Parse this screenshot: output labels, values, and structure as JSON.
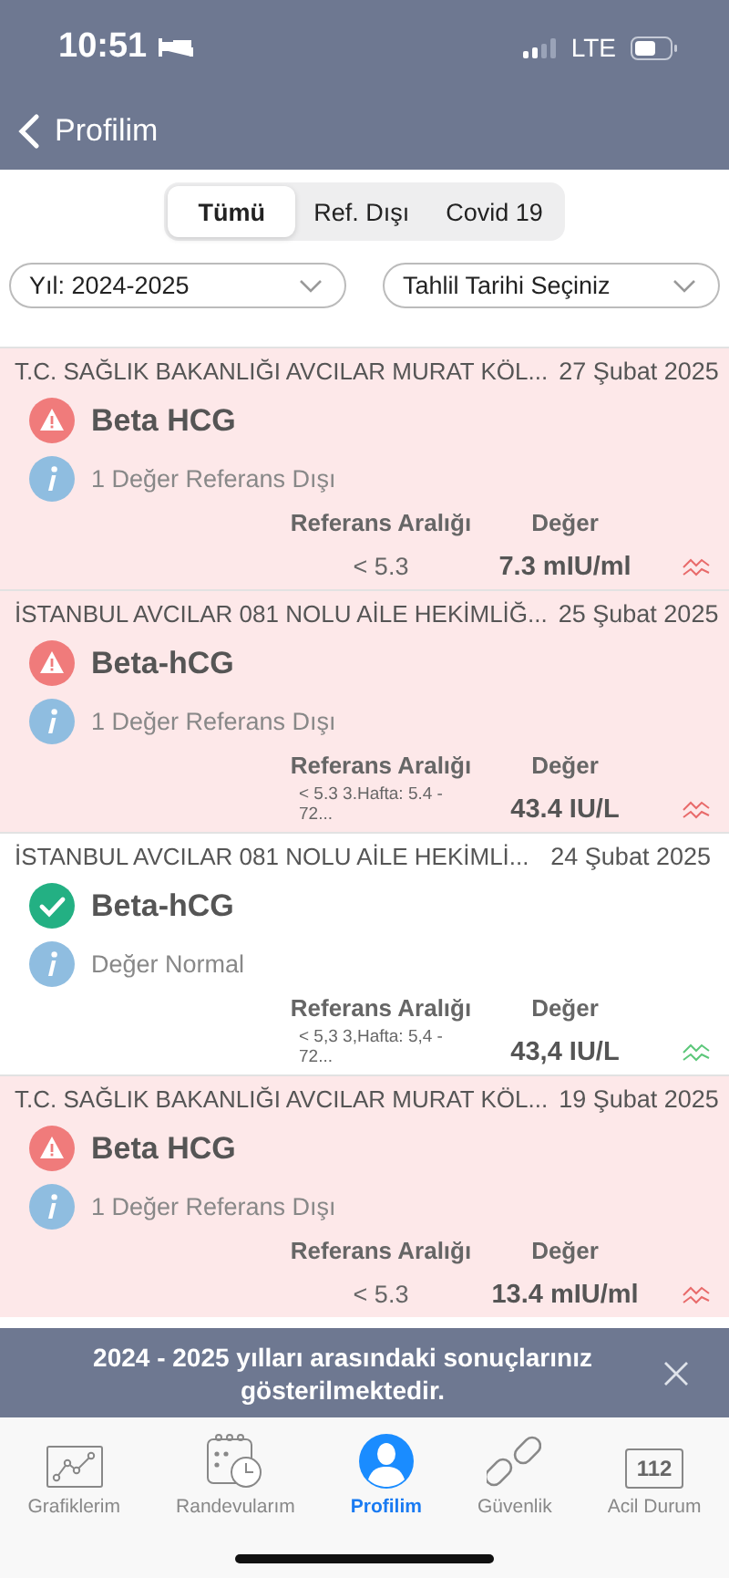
{
  "status_bar": {
    "time": "10:51",
    "network": "LTE"
  },
  "nav": {
    "back": "Profilim"
  },
  "segments": [
    {
      "label": "Tümü",
      "selected": true
    },
    {
      "label": "Ref. Dışı",
      "selected": false
    },
    {
      "label": "Covid 19",
      "selected": false
    }
  ],
  "filters": [
    {
      "value": "Yıl: 2024-2025"
    },
    {
      "value": "Tahlil Tarihi Seçiniz"
    }
  ],
  "results": [
    {
      "facility": "T.C. SAĞLIK BAKANLIĞI AVCILAR MURAT KÖL...",
      "date": "27 Şubat 2025",
      "kind": "abnormal",
      "test": "Beta HCG",
      "note": "1 Değer Referans Dışı",
      "range_label": "Referans Aralığı",
      "value_label": "Değer",
      "range": "< 5.3",
      "value": "7.3 mIU/ml"
    },
    {
      "facility": "İSTANBUL AVCILAR 081 NOLU AİLE HEKİMLİĞ...",
      "date": "25 Şubat 2025",
      "kind": "abnormal",
      "test": "Beta-hCG",
      "note": "1 Değer Referans Dışı",
      "range_label": "Referans Aralığı",
      "value_label": "Değer",
      "range": "< 5.3  3.Hafta: 5.4 - 72...",
      "value": "43.4 IU/L"
    },
    {
      "facility": "İSTANBUL AVCILAR 081 NOLU AİLE HEKİMLİ...",
      "date": "24 Şubat 2025",
      "kind": "normal",
      "test": "Beta-hCG",
      "note": "Değer Normal",
      "range_label": "Referans Aralığı",
      "value_label": "Değer",
      "range": "< 5,3  3,Hafta: 5,4 - 72...",
      "value": "43,4 IU/L"
    },
    {
      "facility": "T.C. SAĞLIK BAKANLIĞI AVCILAR MURAT KÖL...",
      "date": "19 Şubat 2025",
      "kind": "abnormal",
      "test": "Beta HCG",
      "note": "1 Değer Referans Dışı",
      "range_label": "Referans Aralığı",
      "value_label": "Değer",
      "range": "< 5.3",
      "value": "13.4 mIU/ml"
    }
  ],
  "toast": {
    "message": "2024 - 2025 yılları arasındaki sonuçlarınız gösterilmektedir."
  },
  "tab_bar": [
    {
      "label": "Grafiklerim",
      "kind": "chart",
      "selected": false
    },
    {
      "label": "Randevularım",
      "kind": "calendar",
      "selected": false
    },
    {
      "label": "Profilim",
      "kind": "person",
      "selected": true
    },
    {
      "label": "Güvenlik",
      "kind": "link",
      "selected": false
    },
    {
      "label": "Acil Durum",
      "kind": "badge",
      "badge": "112",
      "selected": false
    }
  ]
}
